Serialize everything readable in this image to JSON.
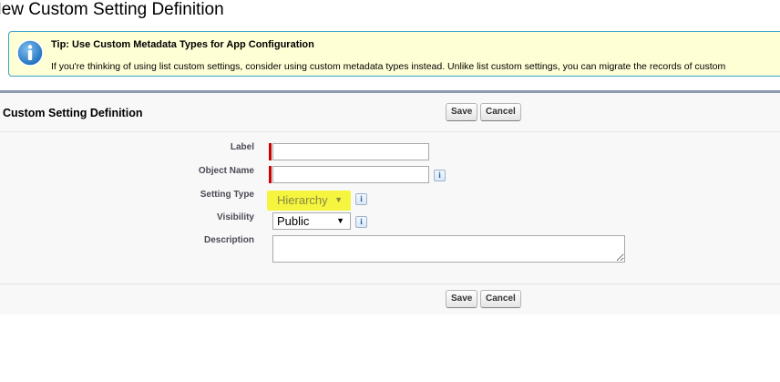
{
  "page": {
    "title": "New Custom Setting Definition"
  },
  "tip": {
    "icon": "info-icon",
    "title": "Tip: Use Custom Metadata Types for App Configuration",
    "body": "If you're thinking of using list custom settings, consider using custom metadata types instead. Unlike list custom settings, you can migrate the records of custom"
  },
  "section": {
    "title": "Custom Setting Definition",
    "save_label": "Save",
    "cancel_label": "Cancel"
  },
  "form": {
    "label": {
      "label": "Label",
      "value": ""
    },
    "object_name": {
      "label": "Object Name",
      "value": ""
    },
    "setting_type": {
      "label": "Setting Type",
      "selected": "Hierarchy"
    },
    "visibility": {
      "label": "Visibility",
      "selected": "Public"
    },
    "description": {
      "label": "Description",
      "value": ""
    },
    "info_glyph": "i",
    "dropdown_glyph": "▼"
  },
  "colors": {
    "tip_border": "#39a3c9",
    "tip_background": "#ffffd6",
    "required_marker": "#cc0000",
    "highlight": "#f5f540",
    "section_border": "#8c99ae"
  }
}
